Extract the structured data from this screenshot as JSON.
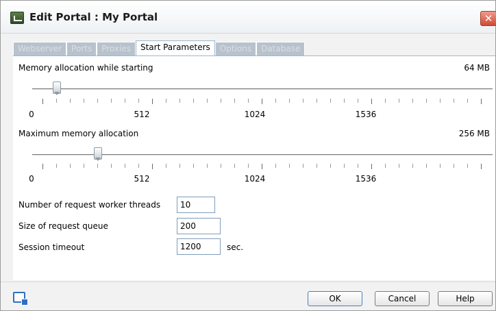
{
  "window": {
    "title": "Edit Portal  : My Portal",
    "close_label": "✕"
  },
  "tabs": [
    {
      "label": "Webserver",
      "active": false
    },
    {
      "label": "Ports",
      "active": false
    },
    {
      "label": "Proxies",
      "active": false
    },
    {
      "label": "Start Parameters",
      "active": true
    },
    {
      "label": "Options",
      "active": false
    },
    {
      "label": "Database",
      "active": false
    }
  ],
  "memory_start": {
    "label": "Memory allocation while starting",
    "value_text": "64 MB",
    "value": 64,
    "min": 0,
    "max": 2048
  },
  "memory_max": {
    "label": "Maximum memory allocation",
    "value_text": "256 MB",
    "value": 256,
    "min": 0,
    "max": 2048
  },
  "tick_labels": [
    "0",
    "512",
    "1024",
    "1536"
  ],
  "fields": {
    "worker_threads": {
      "label": "Number of request worker threads",
      "value": "10"
    },
    "queue_size": {
      "label": "Size of request queue",
      "value": "200"
    },
    "session_timeout": {
      "label": "Session timeout",
      "value": "1200",
      "unit": "sec."
    }
  },
  "buttons": {
    "ok": "OK",
    "cancel": "Cancel",
    "help": "Help"
  },
  "icons": {
    "app": "app-icon",
    "help": "help-icon"
  }
}
